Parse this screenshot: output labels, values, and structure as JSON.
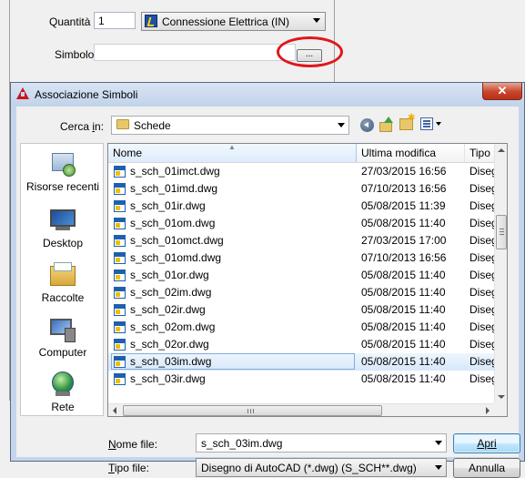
{
  "background_form": {
    "quantity_label": "Quantità",
    "quantity_value": "1",
    "connection_value": "Connessione Elettrica (IN)",
    "symbol_label": "Simbolo",
    "symbol_value": "",
    "browse_button": "...",
    "highlight_color": "#e0161b"
  },
  "dialog": {
    "title": "Associazione Simboli",
    "close": "✕",
    "look_in_label": "Cerca in:",
    "look_in_value": "Schede",
    "toolbar": [
      "back-icon",
      "up-folder-icon",
      "new-folder-icon",
      "view-menu-icon"
    ],
    "places": [
      {
        "label": "Risorse recenti",
        "icon": "recent-places-icon"
      },
      {
        "label": "Desktop",
        "icon": "desktop-icon"
      },
      {
        "label": "Raccolte",
        "icon": "libraries-icon"
      },
      {
        "label": "Computer",
        "icon": "computer-icon"
      },
      {
        "label": "Rete",
        "icon": "network-icon"
      }
    ],
    "columns": [
      "Nome",
      "Ultima modifica",
      "Tipo"
    ],
    "files": [
      {
        "name": "s_sch_01imct.dwg",
        "modified": "27/03/2015 16:56",
        "type": "Disegn"
      },
      {
        "name": "s_sch_01imd.dwg",
        "modified": "07/10/2013 16:56",
        "type": "Disegn"
      },
      {
        "name": "s_sch_01ir.dwg",
        "modified": "05/08/2015 11:39",
        "type": "Disegn"
      },
      {
        "name": "s_sch_01om.dwg",
        "modified": "05/08/2015 11:40",
        "type": "Disegn"
      },
      {
        "name": "s_sch_01omct.dwg",
        "modified": "27/03/2015 17:00",
        "type": "Disegn"
      },
      {
        "name": "s_sch_01omd.dwg",
        "modified": "07/10/2013 16:56",
        "type": "Disegn"
      },
      {
        "name": "s_sch_01or.dwg",
        "modified": "05/08/2015 11:40",
        "type": "Disegn"
      },
      {
        "name": "s_sch_02im.dwg",
        "modified": "05/08/2015 11:40",
        "type": "Disegn"
      },
      {
        "name": "s_sch_02ir.dwg",
        "modified": "05/08/2015 11:40",
        "type": "Disegn"
      },
      {
        "name": "s_sch_02om.dwg",
        "modified": "05/08/2015 11:40",
        "type": "Disegn"
      },
      {
        "name": "s_sch_02or.dwg",
        "modified": "05/08/2015 11:40",
        "type": "Disegn"
      },
      {
        "name": "s_sch_03im.dwg",
        "modified": "05/08/2015 11:40",
        "type": "Disegn",
        "selected": true
      },
      {
        "name": "s_sch_03ir.dwg",
        "modified": "05/08/2015 11:40",
        "type": "Disegn"
      }
    ],
    "file_name_label": "Nome file:",
    "file_name_value": "s_sch_03im.dwg",
    "file_type_label": "Tipo file:",
    "file_type_value": "Disegno di AutoCAD (*.dwg) (S_SCH**.dwg)",
    "open_button": "Apri",
    "cancel_button": "Annulla"
  }
}
